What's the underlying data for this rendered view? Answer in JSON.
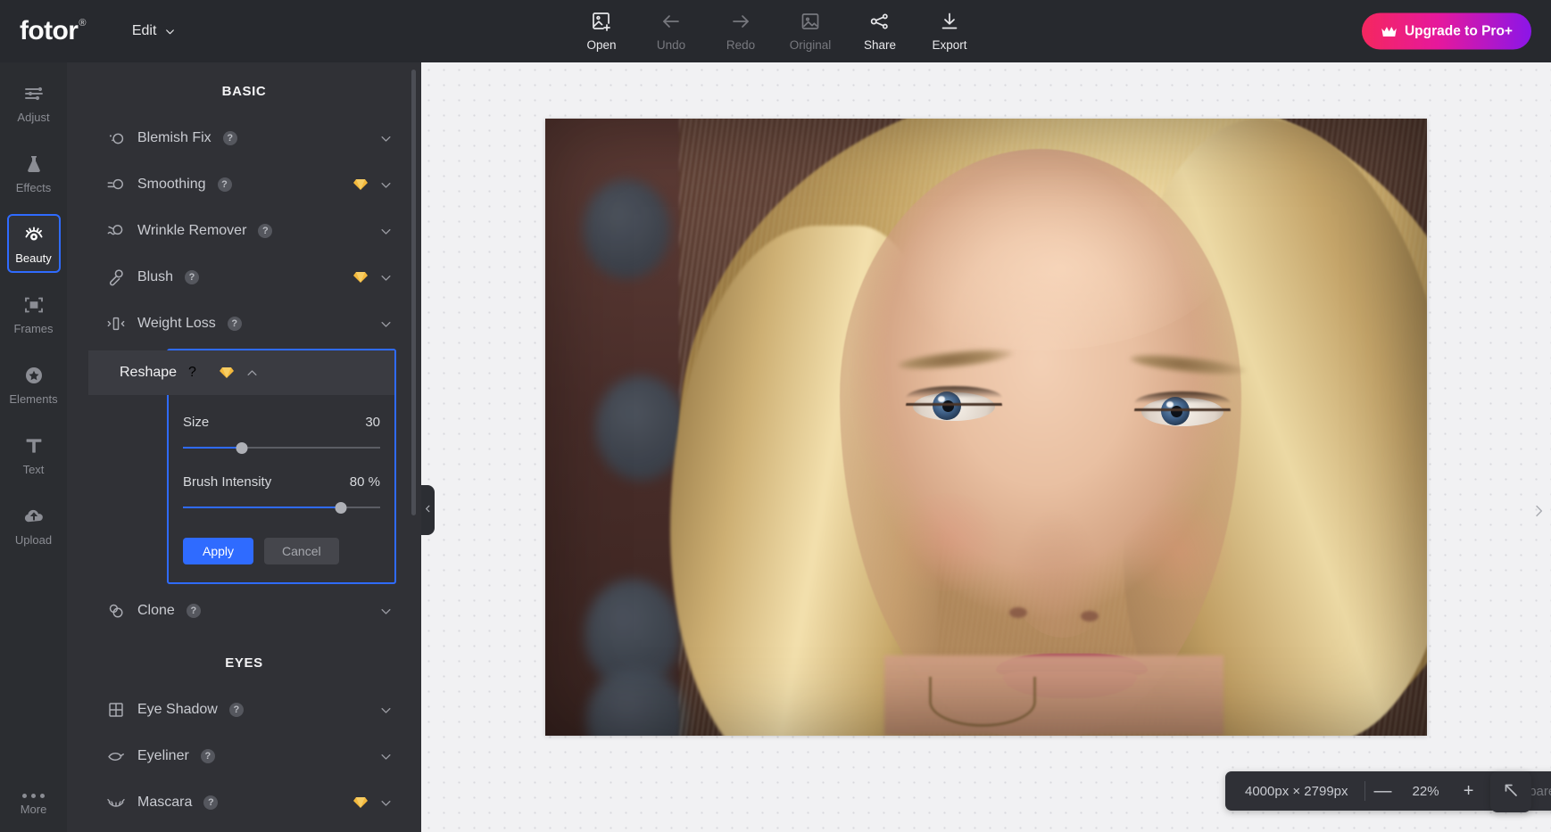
{
  "header": {
    "brand": "fotor",
    "brand_reg": "®",
    "edit_menu": "Edit",
    "tools": [
      {
        "label": "Open",
        "icon": "open-image-icon",
        "enabled": true
      },
      {
        "label": "Undo",
        "icon": "undo-arrow-icon",
        "enabled": false
      },
      {
        "label": "Redo",
        "icon": "redo-arrow-icon",
        "enabled": false
      },
      {
        "label": "Original",
        "icon": "original-image-icon",
        "enabled": false
      },
      {
        "label": "Share",
        "icon": "share-nodes-icon",
        "enabled": true
      },
      {
        "label": "Export",
        "icon": "download-icon",
        "enabled": true
      }
    ],
    "upgrade_label": "Upgrade to Pro+",
    "upgrade_icon": "crown-icon",
    "upgrade_gradient_from": "#f5275f",
    "upgrade_gradient_to": "#8b16e8"
  },
  "rail": {
    "items": [
      {
        "label": "Adjust",
        "icon": "sliders-icon",
        "active": false
      },
      {
        "label": "Effects",
        "icon": "flask-icon",
        "active": false
      },
      {
        "label": "Beauty",
        "icon": "eye-lash-icon",
        "active": true
      },
      {
        "label": "Frames",
        "icon": "frame-icon",
        "active": false
      },
      {
        "label": "Elements",
        "icon": "star-badge-icon",
        "active": false
      },
      {
        "label": "Text",
        "icon": "text-t-icon",
        "active": false
      },
      {
        "label": "Upload",
        "icon": "upload-cloud-icon",
        "active": false
      }
    ],
    "more_label": "More",
    "more_icon": "ellipsis-icon",
    "active_outline_color": "#2f6bff"
  },
  "panel": {
    "sections": [
      {
        "title": "BASIC",
        "rows": [
          {
            "label": "Blemish Fix",
            "icon": "blemish-fix-icon",
            "pro": false,
            "expanded": false
          },
          {
            "label": "Smoothing",
            "icon": "smoothing-icon",
            "pro": true,
            "expanded": false
          },
          {
            "label": "Wrinkle Remover",
            "icon": "wrinkle-remover-icon",
            "pro": false,
            "expanded": false
          },
          {
            "label": "Blush",
            "icon": "blush-icon",
            "pro": true,
            "expanded": false
          },
          {
            "label": "Weight Loss",
            "icon": "weight-loss-icon",
            "pro": false,
            "expanded": false
          }
        ]
      }
    ],
    "active_tool": {
      "label": "Reshape",
      "icon": "reshape-icon",
      "pro": true,
      "expanded": true,
      "help_glyph": "?",
      "outline_color": "#2f6bff",
      "sliders": [
        {
          "label": "Size",
          "value": "30",
          "percent": 30,
          "unit": ""
        },
        {
          "label": "Brush Intensity",
          "value": "80 %",
          "percent": 80,
          "unit": "%"
        }
      ],
      "apply_label": "Apply",
      "cancel_label": "Cancel",
      "accent_color": "#2f6bff"
    },
    "after_active_rows": [
      {
        "label": "Clone",
        "icon": "clone-icon",
        "pro": false,
        "expanded": false
      }
    ],
    "eyes_section": {
      "title": "EYES",
      "rows": [
        {
          "label": "Eye Shadow",
          "icon": "eye-shadow-icon",
          "pro": false,
          "expanded": false
        },
        {
          "label": "Eyeliner",
          "icon": "eyeliner-icon",
          "pro": false,
          "expanded": false
        },
        {
          "label": "Mascara",
          "icon": "mascara-icon",
          "pro": true,
          "expanded": false
        }
      ]
    },
    "collapse_handle_icon": "chevron-left-icon"
  },
  "canvas": {
    "expand_handle_icon": "chevron-right-icon",
    "photo_alt": "portrait-of-blonde-woman",
    "zoombar": {
      "dimensions": "4000px × 2799px",
      "zoom_out_glyph": "—",
      "zoom_level": "22%",
      "zoom_in_glyph": "+",
      "compare_label": "Compare"
    },
    "corner_button_icon": "arrow-up-left-icon"
  }
}
